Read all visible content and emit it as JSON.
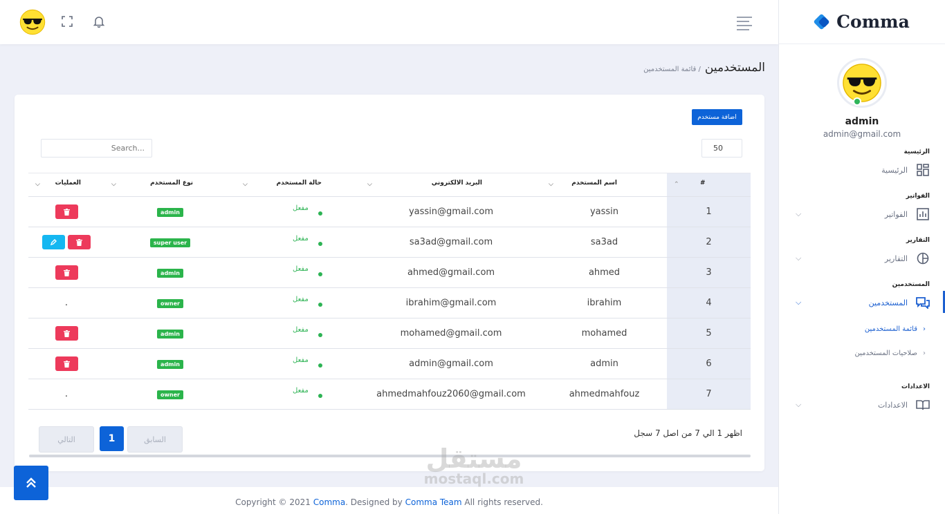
{
  "brand": {
    "name": "Comma"
  },
  "profile": {
    "name": "admin",
    "email": "admin@gmail.com"
  },
  "nav": {
    "home_section": "الرئيسية",
    "home_item": "الرئيسية",
    "invoices_section": "الفواتير",
    "invoices_item": "الفواتير",
    "reports_section": "التقارير",
    "reports_item": "التقارير",
    "users_section": "المستخدمين",
    "users_item": "المستخدمين",
    "users_sub": [
      "قائمة المستخدمين",
      "صلاحيات المستخدمين"
    ],
    "settings_section": "الاعدادات",
    "settings_item": "الاعدادات"
  },
  "page": {
    "title": "المستخدمين",
    "breadcrumb": "/ قائمة المستخدمين"
  },
  "toolbar": {
    "add_user": "اضافة مستخدم",
    "search_placeholder": "Search...",
    "per_page": "50"
  },
  "table": {
    "headers": {
      "num": "#",
      "name": "اسم المستخدم",
      "email": "البريد الالكتروني",
      "status": "حالة المستخدم",
      "type": "نوع المستخدم",
      "actions": "العمليات"
    },
    "rows": [
      {
        "num": "1",
        "name": "yassin",
        "email": "yassin@gmail.com",
        "status": "مفعل",
        "type": "admin",
        "actions": "delete"
      },
      {
        "num": "2",
        "name": "sa3ad",
        "email": "sa3ad@gmail.com",
        "status": "مفعل",
        "type": "super user",
        "actions": "edit-delete"
      },
      {
        "num": "3",
        "name": "ahmed",
        "email": "ahmed@gmail.com",
        "status": "مفعل",
        "type": "admin",
        "actions": "delete"
      },
      {
        "num": "4",
        "name": "ibrahim",
        "email": "ibrahim@gmail.com",
        "status": "مفعل",
        "type": "owner",
        "actions": "none"
      },
      {
        "num": "5",
        "name": "mohamed",
        "email": "mohamed@gmail.com",
        "status": "مفعل",
        "type": "admin",
        "actions": "delete"
      },
      {
        "num": "6",
        "name": "admin",
        "email": "admin@gmail.com",
        "status": "مفعل",
        "type": "admin",
        "actions": "delete"
      },
      {
        "num": "7",
        "name": "ahmedmahfouz",
        "email": "ahmedmahfouz2060@gmail.com",
        "status": "مفعل",
        "type": "owner",
        "actions": "none"
      }
    ],
    "empty_action": "."
  },
  "pagination": {
    "info": "اظهر 1 الي 7 من اصل 7 سجل",
    "prev": "السابق",
    "next": "التالي",
    "current": "1"
  },
  "footer": {
    "prefix": "Copyright © 2021 ",
    "brand": "Comma",
    "mid": ". Designed by ",
    "team": "Comma Team",
    "suffix": " All rights reserved."
  },
  "watermark": {
    "ar": "مستقل",
    "en": "mostaql.com"
  },
  "colors": {
    "primary": "#0d63d8",
    "success": "#2bb44b",
    "danger": "#ed3a5b",
    "info": "#15b7f1"
  }
}
